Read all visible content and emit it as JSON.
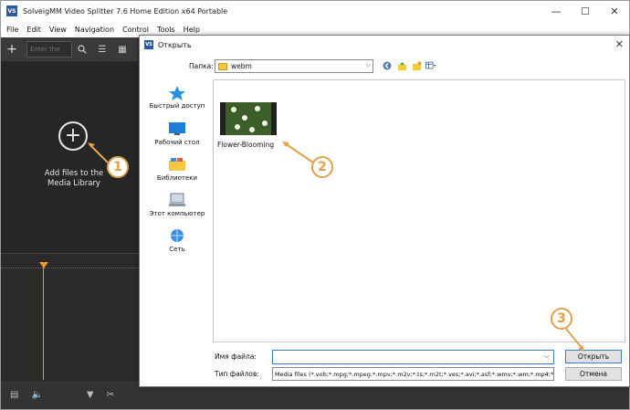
{
  "app": {
    "title": "SolveigMM Video Splitter 7.6 Home Edition x64 Portable",
    "logo_text": "VS",
    "window_buttons": [
      "—",
      "☐",
      "✕"
    ],
    "menu": [
      "File",
      "Edit",
      "View",
      "Navigation",
      "Control",
      "Tools",
      "Help"
    ],
    "toolbar": {
      "add_icon": "plus-icon",
      "search_placeholder": "Enter the",
      "icons": [
        "search-icon",
        "list-view-icon",
        "grid-view-icon"
      ]
    },
    "media_library": {
      "add_text": "Add files to the Media Library",
      "add_icon": "plus-circle-icon"
    },
    "bottom_icons": [
      "film-icon",
      "volume-icon",
      "filter-icon",
      "cut-icon"
    ],
    "colors": {
      "background": "#2b2b2b",
      "playhead": "#e89a2c"
    }
  },
  "dialog": {
    "title": "Открыть",
    "logo_text": "VS",
    "close": "✕",
    "look_in_label": "Папка:",
    "look_in_value": "webm",
    "nav_icons": [
      "back-icon",
      "up-folder-icon",
      "new-folder-icon",
      "view-menu-icon"
    ],
    "places": [
      {
        "label": "Быстрый доступ",
        "icon": "star-icon"
      },
      {
        "label": "Рабочий стол",
        "icon": "desktop-icon"
      },
      {
        "label": "Библиотеки",
        "icon": "libraries-icon"
      },
      {
        "label": "Этот компьютер",
        "icon": "computer-icon"
      },
      {
        "label": "Сеть",
        "icon": "network-icon"
      }
    ],
    "files": [
      {
        "name": "Flower-Blooming",
        "icon": "video-thumbnail-icon"
      }
    ],
    "filename_label": "Имя файла:",
    "filename_value": "",
    "filetype_label": "Тип файлов:",
    "filetype_value": "Media files (*.vob;*.mpg;*.mpeg;*.mpv;*.m2v;*.ts;*.m2t;*.ves;*.avi;*.asf;*.wmv;*.wm;*.mp4;*.m",
    "open_button": "Открыть",
    "cancel_button": "Отмена"
  },
  "callouts": [
    "1",
    "2",
    "3"
  ],
  "colors": {
    "callout": "#e0a24a",
    "focus_border": "#3a78c8"
  }
}
